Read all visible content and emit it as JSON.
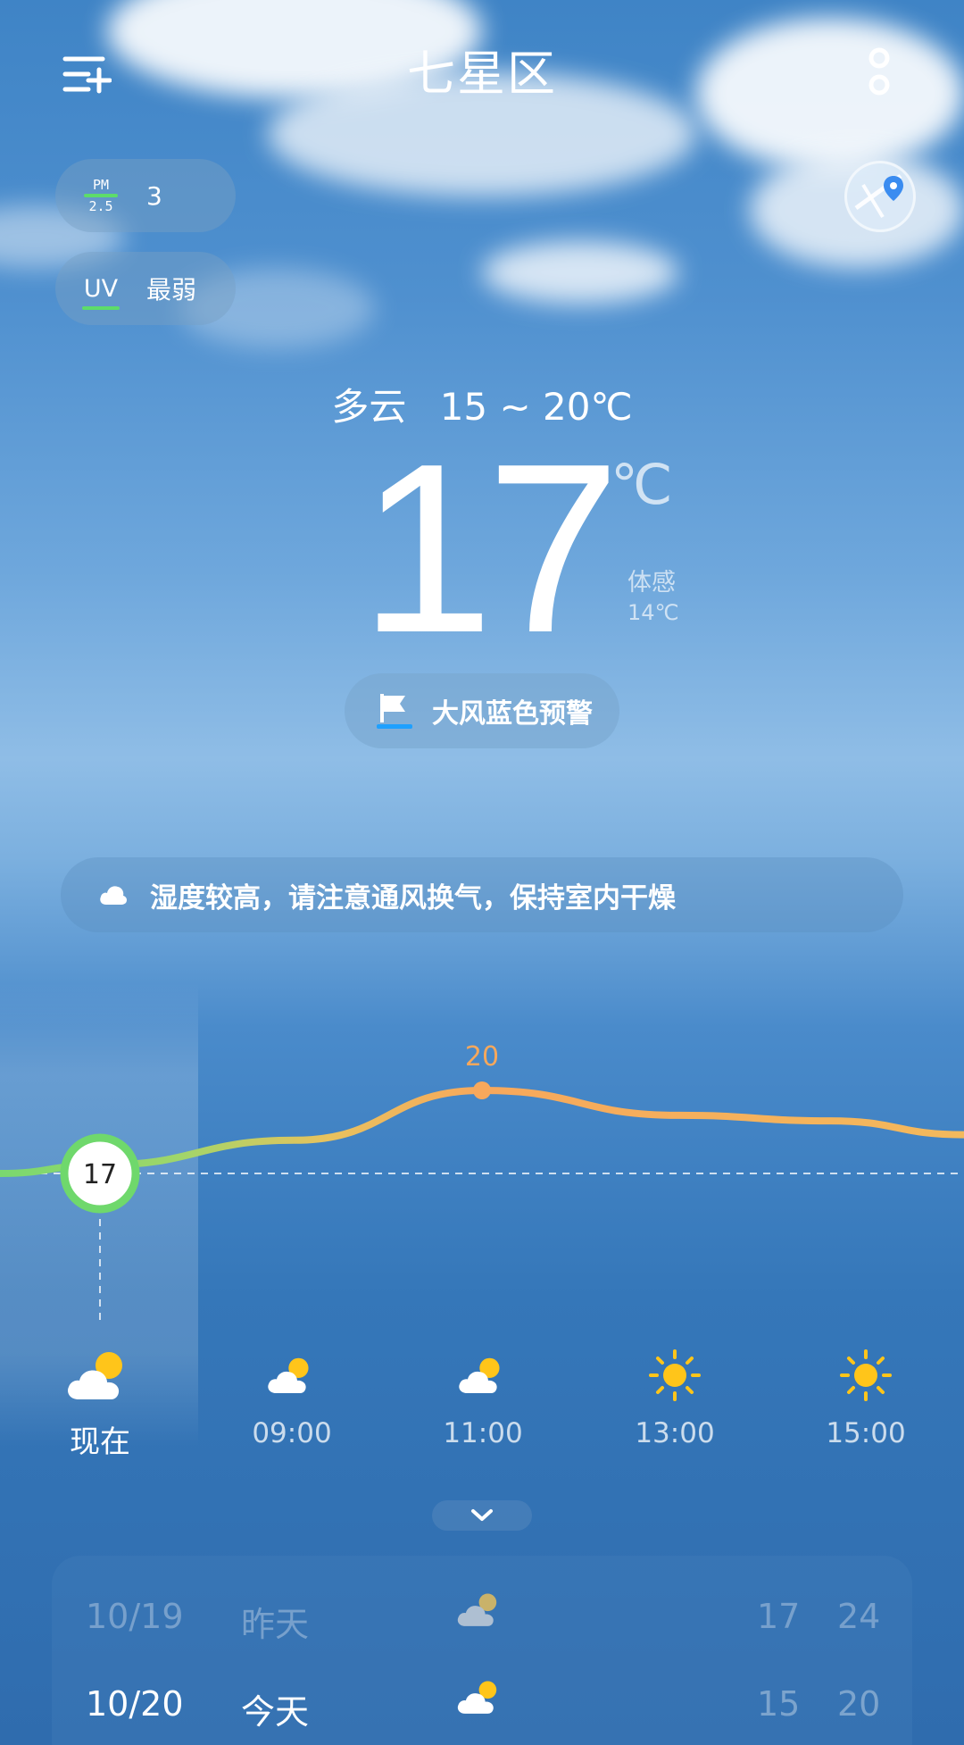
{
  "header": {
    "title": "七星区"
  },
  "pm25": {
    "icon_text_top": "PM",
    "icon_text_bottom": "2.5",
    "value": "3"
  },
  "uv": {
    "icon_text": "UV",
    "value": "最弱"
  },
  "current": {
    "condition": "多云",
    "range": "15 ~ 20℃",
    "temp": "17",
    "unit": "℃",
    "feels_label": "体感",
    "feels_value": "14℃"
  },
  "alert": {
    "text": "大风蓝色预警",
    "color": "#1ea0ff"
  },
  "tip": {
    "text": "湿度较高，请注意通风换气，保持室内干燥"
  },
  "hourly": {
    "temps_shown": [
      {
        "label": "17",
        "value": 17
      },
      {
        "label": "20",
        "value": 20
      }
    ],
    "curve_values": [
      17,
      17.3,
      18.2,
      20,
      19.1,
      18.9,
      18.4
    ],
    "items": [
      {
        "label": "现在",
        "icon": "partly-cloudy-icon"
      },
      {
        "label": "09:00",
        "icon": "partly-cloudy-icon"
      },
      {
        "label": "11:00",
        "icon": "partly-cloudy-icon"
      },
      {
        "label": "13:00",
        "icon": "sun-icon"
      },
      {
        "label": "15:00",
        "icon": "sun-icon"
      }
    ]
  },
  "daily": [
    {
      "date": "10/19",
      "name": "昨天",
      "icon": "cloudy-icon",
      "low": "17",
      "high": "24"
    },
    {
      "date": "10/20",
      "name": "今天",
      "icon": "partly-cloudy-icon",
      "low": "15",
      "high": "20"
    }
  ],
  "colors": {
    "accent_green": "#5ddc6a",
    "accent_orange": "#f7a85c",
    "sun_yellow": "#ffc51a"
  }
}
